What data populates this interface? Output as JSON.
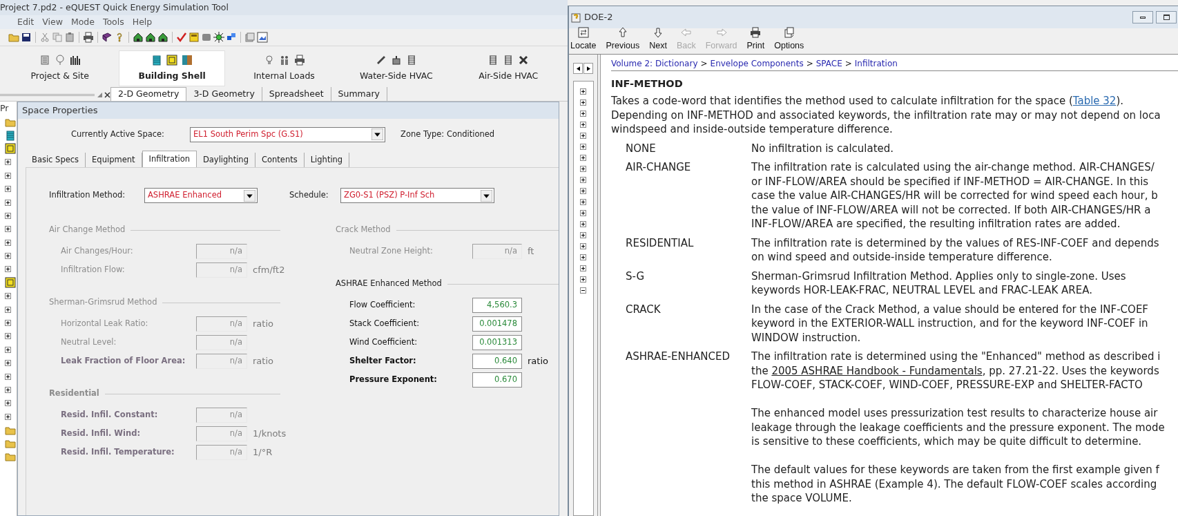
{
  "app": {
    "title": "Project 7.pd2 - eQUEST Quick Energy Simulation Tool",
    "menu": [
      "Edit",
      "View",
      "Mode",
      "Tools",
      "Help"
    ],
    "modules": [
      {
        "label": "Project & Site",
        "selected": false
      },
      {
        "label": "Building Shell",
        "selected": true
      },
      {
        "label": "Internal Loads",
        "selected": false
      },
      {
        "label": "Water-Side HVAC",
        "selected": false
      },
      {
        "label": "Air-Side HVAC",
        "selected": false
      }
    ],
    "view_tabs": [
      {
        "label": "2-D Geometry",
        "selected": true
      },
      {
        "label": "3-D Geometry",
        "selected": false
      },
      {
        "label": "Spreadsheet",
        "selected": false
      },
      {
        "label": "Summary",
        "selected": false
      }
    ],
    "side_label": "Pr",
    "tree": [
      {
        "kind": "folder"
      },
      {
        "kind": "building"
      },
      {
        "kind": "floor"
      },
      {
        "kind": "node",
        "expanded": false
      },
      {
        "kind": "node",
        "expanded": false
      },
      {
        "kind": "node",
        "expanded": false
      },
      {
        "kind": "node",
        "expanded": false
      },
      {
        "kind": "node",
        "expanded": false
      },
      {
        "kind": "node",
        "expanded": false
      },
      {
        "kind": "node",
        "expanded": false
      },
      {
        "kind": "node",
        "expanded": false
      },
      {
        "kind": "node",
        "expanded": false
      },
      {
        "kind": "floor"
      },
      {
        "kind": "node",
        "expanded": false
      },
      {
        "kind": "node",
        "expanded": false
      },
      {
        "kind": "node",
        "expanded": false
      },
      {
        "kind": "node",
        "expanded": false
      },
      {
        "kind": "node",
        "expanded": false
      },
      {
        "kind": "node",
        "expanded": false
      },
      {
        "kind": "node",
        "expanded": false
      },
      {
        "kind": "node",
        "expanded": false
      },
      {
        "kind": "node",
        "expanded": false
      },
      {
        "kind": "node",
        "expanded": false
      },
      {
        "kind": "folder"
      },
      {
        "kind": "folder"
      },
      {
        "kind": "folder"
      }
    ]
  },
  "dialog": {
    "title": "Space Properties",
    "active_space_label": "Currently Active Space:",
    "active_space": "EL1 South Perim Spc (G.S1)",
    "zone_type": "Zone Type: Conditioned",
    "tabs": [
      {
        "label": "Basic Specs",
        "selected": false
      },
      {
        "label": "Equipment",
        "selected": false
      },
      {
        "label": "Infiltration",
        "selected": true
      },
      {
        "label": "Daylighting",
        "selected": false
      },
      {
        "label": "Contents",
        "selected": false
      },
      {
        "label": "Lighting",
        "selected": false
      }
    ],
    "method_label": "Infiltration Method:",
    "method": "ASHRAE Enhanced",
    "schedule_label": "Schedule:",
    "schedule": "ZG0-S1 (PSZ) P-Inf Sch",
    "columns": [
      [
        {
          "title": "Air Change Method",
          "disabled": true,
          "bold": false,
          "fields": [
            {
              "label": "Air Changes/Hour:",
              "value": "n/a",
              "disabled": true,
              "bold": false
            },
            {
              "label": "Infiltration Flow:",
              "value": "n/a",
              "unit": "cfm/ft2",
              "disabled": true,
              "bold": false
            }
          ]
        },
        {
          "title": "Sherman-Grimsrud Method",
          "disabled": true,
          "bold": false,
          "fields": [
            {
              "label": "Horizontal Leak Ratio:",
              "value": "n/a",
              "unit": "ratio",
              "disabled": true,
              "bold": false
            },
            {
              "label": "Neutral Level:",
              "value": "n/a",
              "disabled": true,
              "bold": false
            },
            {
              "label": "Leak Fraction of Floor Area:",
              "value": "n/a",
              "unit": "ratio",
              "disabled": true,
              "bold": true
            }
          ]
        },
        {
          "title": "Residential",
          "disabled": true,
          "bold": true,
          "fields": [
            {
              "label": "Resid. Infil. Constant:",
              "value": "n/a",
              "disabled": true,
              "bold": true
            },
            {
              "label": "Resid. Infil. Wind:",
              "value": "n/a",
              "unit": "1/knots",
              "disabled": true,
              "bold": true
            },
            {
              "label": "Resid. Infil. Temperature:",
              "value": "n/a",
              "unit": "1/°R",
              "disabled": true,
              "bold": true
            }
          ]
        }
      ],
      [
        {
          "title": "Crack Method",
          "disabled": true,
          "bold": false,
          "fields": [
            {
              "label": "Neutral Zone Height:",
              "value": "n/a",
              "unit": "ft",
              "disabled": true,
              "bold": false
            }
          ]
        },
        {
          "title": "ASHRAE Enhanced Method",
          "disabled": false,
          "bold": false,
          "fields": [
            {
              "label": "Flow Coefficient:",
              "value": "4,560.3",
              "disabled": false,
              "bold": false
            },
            {
              "label": "Stack Coefficient:",
              "value": "0.001478",
              "disabled": false,
              "bold": false
            },
            {
              "label": "Wind Coefficient:",
              "value": "0.001313",
              "disabled": false,
              "bold": false
            },
            {
              "label": "Shelter Factor:",
              "value": "0.640",
              "unit": "ratio",
              "disabled": false,
              "bold": true
            },
            {
              "label": "Pressure Exponent:",
              "value": "0.670",
              "disabled": false,
              "bold": true
            }
          ]
        }
      ]
    ]
  },
  "help": {
    "title": "DOE-2",
    "toolbar": [
      {
        "label": "Locate",
        "kind": "locate",
        "disabled": false
      },
      {
        "label": "Previous",
        "kind": "up",
        "disabled": false
      },
      {
        "label": "Next",
        "kind": "down",
        "disabled": false
      },
      {
        "label": "Back",
        "kind": "left",
        "disabled": true
      },
      {
        "label": "Forward",
        "kind": "right",
        "disabled": true
      },
      {
        "label": "Print",
        "kind": "print",
        "disabled": false
      },
      {
        "label": "Options",
        "kind": "options",
        "disabled": false
      }
    ],
    "nav_tree": [
      {
        "expanded": false
      },
      {
        "expanded": false
      },
      {
        "expanded": false
      },
      {
        "expanded": false
      },
      {
        "expanded": false
      },
      {
        "expanded": false
      },
      {
        "expanded": false
      },
      {
        "expanded": false
      },
      {
        "expanded": false
      },
      {
        "expanded": false
      },
      {
        "expanded": false
      },
      {
        "expanded": false
      },
      {
        "expanded": false
      },
      {
        "expanded": false
      },
      {
        "expanded": false
      },
      {
        "expanded": false
      },
      {
        "expanded": false
      },
      {
        "expanded": false
      },
      {
        "expanded": true
      }
    ],
    "breadcrumb": [
      "Volume 2: Dictionary",
      "Envelope Components",
      "SPACE",
      "Infiltration"
    ],
    "breadcrumb_separator": ">",
    "heading": "INF-METHOD",
    "intro": [
      {
        "before": "Takes a code-word that identifies the method used to calculate infiltration for the space (",
        "link": "Table 32",
        "after": ").",
        "kind": "hyperlink"
      },
      "Depending on INF-METHOD and associated keywords, the infiltration rate may or may not depend on loca",
      "windspeed and inside-outside temperature difference."
    ],
    "definitions": [
      {
        "term": "NONE",
        "paragraphs": [
          [
            "No infiltration is calculated."
          ]
        ]
      },
      {
        "term": "AIR-CHANGE",
        "paragraphs": [
          [
            "The infiltration rate is calculated using the air-change method. AIR-CHANGES/",
            "or INF-FLOW/AREA should be specified if INF-METHOD = AIR-CHANGE. In this",
            "case the value AIR-CHANGES/HR will be corrected for wind speed each hour, b",
            "the value of INF-FLOW/AREA will not be corrected. If both AIR-CHANGES/HR a",
            "INF-FLOW/AREA are specified, the resulting infiltration rates are added."
          ]
        ]
      },
      {
        "term": "RESIDENTIAL",
        "paragraphs": [
          [
            "The infiltration rate is determined by the values of RES-INF-COEF and depends",
            "on wind speed and outside-inside temperature difference."
          ]
        ]
      },
      {
        "term": "S-G",
        "paragraphs": [
          [
            "Sherman-Grimsrud Infiltration Method. Applies only to single-zone. Uses",
            "keywords HOR-LEAK-FRAC, NEUTRAL LEVEL and FRAC-LEAK AREA."
          ]
        ]
      },
      {
        "term": "CRACK",
        "paragraphs": [
          [
            "In the case of the Crack Method, a value should be entered for the INF-COEF",
            "keyword in the EXTERIOR-WALL instruction, and for the keyword INF-COEF in",
            "WINDOW instruction."
          ]
        ]
      },
      {
        "term": "ASHRAE-ENHANCED",
        "paragraphs": [
          [
            "The infiltration rate is determined using the \"Enhanced\" method as described i",
            {
              "before": "the ",
              "link": "2005 ASHRAE Handbook - Fundamentals",
              "after": ", pp. 27.21-22. Uses the keywords",
              "kind": "citation"
            },
            "FLOW-COEF, STACK-COEF, WIND-COEF, PRESSURE-EXP and SHELTER-FACTO"
          ],
          [
            "The enhanced model uses pressurization test results to characterize house air",
            "leakage through the leakage coefficients and the pressure exponent. The mode",
            "is sensitive to these coefficients, which may be quite difficult to determine."
          ],
          [
            "The default values for these keywords are taken from the first example given f",
            "this method in ASHRAE (Example 4). The default FLOW-COEF scales according",
            "the space VOLUME."
          ]
        ]
      }
    ]
  }
}
